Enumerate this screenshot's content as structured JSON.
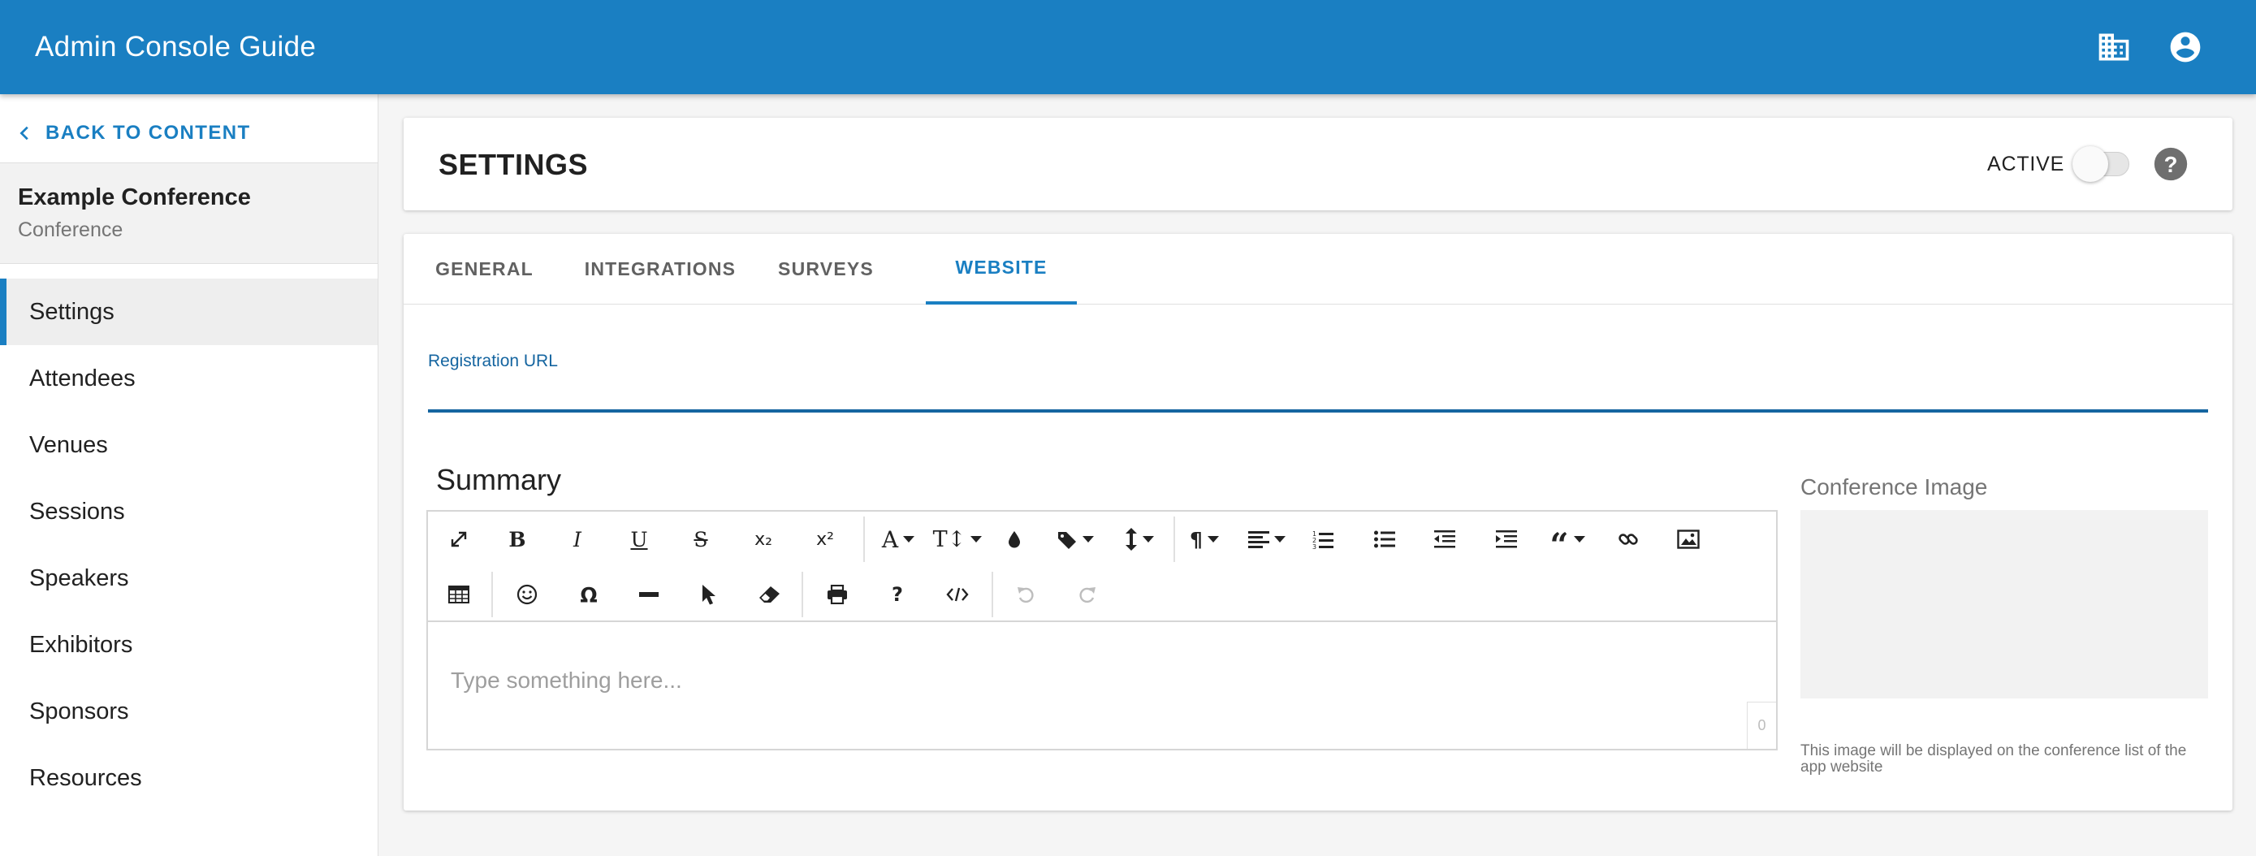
{
  "appbar": {
    "title": "Admin Console Guide",
    "icons": [
      "building-icon",
      "account-circle-icon"
    ],
    "color": "#1a7fc2"
  },
  "sidebar": {
    "back_label": "BACK TO CONTENT",
    "conference_name": "Example Conference",
    "conference_type": "Conference",
    "items": [
      {
        "label": "Settings",
        "active": true
      },
      {
        "label": "Attendees",
        "active": false
      },
      {
        "label": "Venues",
        "active": false
      },
      {
        "label": "Sessions",
        "active": false
      },
      {
        "label": "Speakers",
        "active": false
      },
      {
        "label": "Exhibitors",
        "active": false
      },
      {
        "label": "Sponsors",
        "active": false
      },
      {
        "label": "Resources",
        "active": false
      }
    ]
  },
  "settings": {
    "title": "SETTINGS",
    "active_label": "ACTIVE",
    "active_on": false
  },
  "tabs": [
    {
      "label": "GENERAL",
      "active": false
    },
    {
      "label": "INTEGRATIONS",
      "active": false
    },
    {
      "label": "SURVEYS",
      "active": false
    },
    {
      "label": "WEBSITE",
      "active": true
    }
  ],
  "website": {
    "registration_url_label": "Registration URL",
    "registration_url_value": "",
    "summary_title": "Summary",
    "editor_placeholder": "Type something here...",
    "char_count": "0",
    "image_label": "Conference Image",
    "image_help": "This image will be displayed on the conference list of the app website"
  },
  "toolbar": {
    "row1": [
      "fullscreen-icon",
      "bold-icon",
      "italic-icon",
      "underline-icon",
      "strikethrough-icon",
      "subscript-icon",
      "superscript-icon",
      "font-family-icon",
      "font-size-icon",
      "text-color-icon",
      "paragraph-style-icon",
      "line-height-icon",
      "paragraph-format-icon",
      "align-icon",
      "ordered-list-icon",
      "unordered-list-icon",
      "outdent-icon",
      "indent-icon",
      "quote-icon",
      "link-icon",
      "image-icon"
    ],
    "row2": [
      "table-icon",
      "emoticon-icon",
      "special-character-icon",
      "horizontal-line-icon",
      "select-all-icon",
      "clear-formatting-icon",
      "print-icon",
      "help-icon",
      "code-view-icon",
      "undo-icon",
      "redo-icon"
    ]
  }
}
